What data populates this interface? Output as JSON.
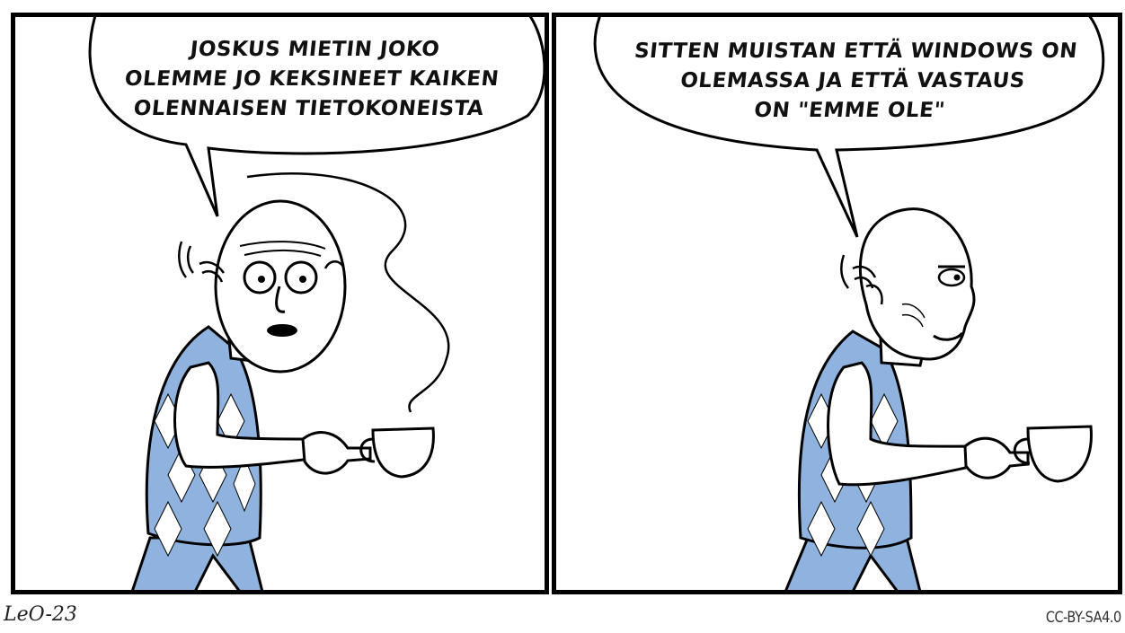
{
  "comic": {
    "panel1": {
      "speech": [
        "JOSKUS MIETIN JOKO",
        "OLEMME JO KEKSINEET KAIKEN",
        "OLENNAISEN TIETOKONEISTA"
      ]
    },
    "panel2": {
      "speech": [
        "SITTEN MUISTAN ETTÄ WINDOWS ON",
        "OLEMASSA JA ETTÄ VASTAUS",
        "ON \"EMME OLE\""
      ]
    },
    "signature": "LeO-23",
    "license": "CC-BY-SA4.0"
  },
  "colors": {
    "vest_blue": "#8fb3de",
    "ink": "#000000"
  }
}
